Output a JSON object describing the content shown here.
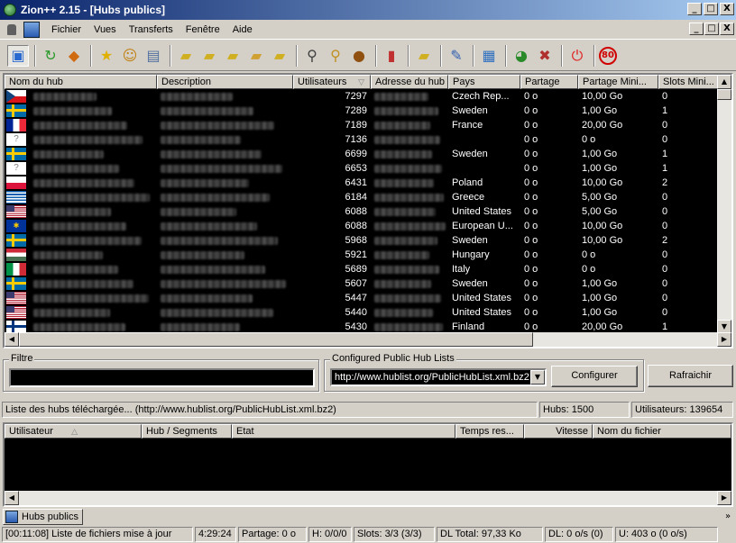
{
  "window": {
    "title": "Zion++ 2.15 - [Hubs publics]",
    "minimize": "_",
    "restore": "□",
    "close": "X"
  },
  "menu": [
    "Fichier",
    "Vues",
    "Transferts",
    "Fenêtre",
    "Aide"
  ],
  "toolbar_icons": [
    "public-hubs-icon",
    "reconnect-icon",
    "follow-redirect-icon",
    "favorites-icon",
    "users-icon",
    "notepad-icon",
    "download-queue-icon",
    "finished-downloads-icon",
    "upload-queue-icon",
    "finished-uploads-icon",
    "waiting-users-icon",
    "search-icon",
    "adl-search-icon",
    "search-spy-icon",
    "network-stats-icon",
    "open-filelist-icon",
    "settings-icon",
    "notepad2-icon",
    "hash-progress-icon",
    "away-icon",
    "shutdown-icon",
    "speed-limit-icon"
  ],
  "hub_columns": [
    "Nom du hub",
    "Description",
    "Utilisateurs",
    "Adresse du hub",
    "Pays",
    "Partage",
    "Partage Mini...",
    "Slots Mini..."
  ],
  "hubs": [
    {
      "flag": "cz",
      "users": "7297",
      "country": "Czech Rep...",
      "share": "0 o",
      "min_share": "10,00 Go",
      "min_slots": "0"
    },
    {
      "flag": "se",
      "users": "7289",
      "country": "Sweden",
      "share": "0 o",
      "min_share": "1,00 Go",
      "min_slots": "1"
    },
    {
      "flag": "fr",
      "users": "7189",
      "country": "France",
      "share": "0 o",
      "min_share": "20,00 Go",
      "min_slots": "0"
    },
    {
      "flag": "unknown",
      "users": "7136",
      "country": "",
      "share": "0 o",
      "min_share": "0 o",
      "min_slots": "0"
    },
    {
      "flag": "se",
      "users": "6699",
      "country": "Sweden",
      "share": "0 o",
      "min_share": "1,00 Go",
      "min_slots": "1"
    },
    {
      "flag": "unknown",
      "users": "6653",
      "country": "",
      "share": "0 o",
      "min_share": "1,00 Go",
      "min_slots": "1"
    },
    {
      "flag": "pl",
      "users": "6431",
      "country": "Poland",
      "share": "0 o",
      "min_share": "10,00 Go",
      "min_slots": "2"
    },
    {
      "flag": "gr",
      "users": "6184",
      "country": "Greece",
      "share": "0 o",
      "min_share": "5,00 Go",
      "min_slots": "0"
    },
    {
      "flag": "us",
      "users": "6088",
      "country": "United States",
      "share": "0 o",
      "min_share": "5,00 Go",
      "min_slots": "0"
    },
    {
      "flag": "eu",
      "users": "6088",
      "country": "European U...",
      "share": "0 o",
      "min_share": "10,00 Go",
      "min_slots": "0"
    },
    {
      "flag": "se",
      "users": "5968",
      "country": "Sweden",
      "share": "0 o",
      "min_share": "10,00 Go",
      "min_slots": "2"
    },
    {
      "flag": "hu",
      "users": "5921",
      "country": "Hungary",
      "share": "0 o",
      "min_share": "0 o",
      "min_slots": "0"
    },
    {
      "flag": "it",
      "users": "5689",
      "country": "Italy",
      "share": "0 o",
      "min_share": "0 o",
      "min_slots": "0"
    },
    {
      "flag": "se",
      "users": "5607",
      "country": "Sweden",
      "share": "0 o",
      "min_share": "1,00 Go",
      "min_slots": "0"
    },
    {
      "flag": "us",
      "users": "5447",
      "country": "United States",
      "share": "0 o",
      "min_share": "1,00 Go",
      "min_slots": "0"
    },
    {
      "flag": "us",
      "users": "5440",
      "country": "United States",
      "share": "0 o",
      "min_share": "1,00 Go",
      "min_slots": "0"
    },
    {
      "flag": "fi",
      "users": "5430",
      "country": "Finland",
      "share": "0 o",
      "min_share": "20,00 Go",
      "min_slots": "1"
    }
  ],
  "filter": {
    "label": "Filtre",
    "value": ""
  },
  "hublists": {
    "label": "Configured Public Hub Lists",
    "selected": "http://www.hublist.org/PublicHubList.xml.bz2",
    "configure": "Configurer",
    "refresh": "Rafraichir"
  },
  "list_status": {
    "message": "Liste des hubs téléchargée... (http://www.hublist.org/PublicHubList.xml.bz2)",
    "hubs": "Hubs: 1500",
    "users": "Utilisateurs: 139654"
  },
  "transfer_columns": [
    "Utilisateur",
    "Hub / Segments",
    "Etat",
    "Temps res...",
    "Vitesse",
    "Nom du fichier"
  ],
  "tab": {
    "label": "Hubs publics"
  },
  "status": {
    "log": "[00:11:08] Liste de fichiers mise à jour",
    "time": "4:29:24",
    "share": "Partage: 0 o",
    "hubs": "H: 0/0/0",
    "slots": "Slots: 3/3 (3/3)",
    "dl_total": "DL Total: 97,33 Ko",
    "dl": "DL: 0 o/s (0)",
    "ul": "U: 403 o (0 o/s)"
  },
  "colors": {
    "titlebar_start": "#0a246a",
    "titlebar_end": "#a6caf0",
    "grid_bg": "#000000",
    "grid_text": "#ffffff",
    "chrome": "#d4d0c8"
  }
}
